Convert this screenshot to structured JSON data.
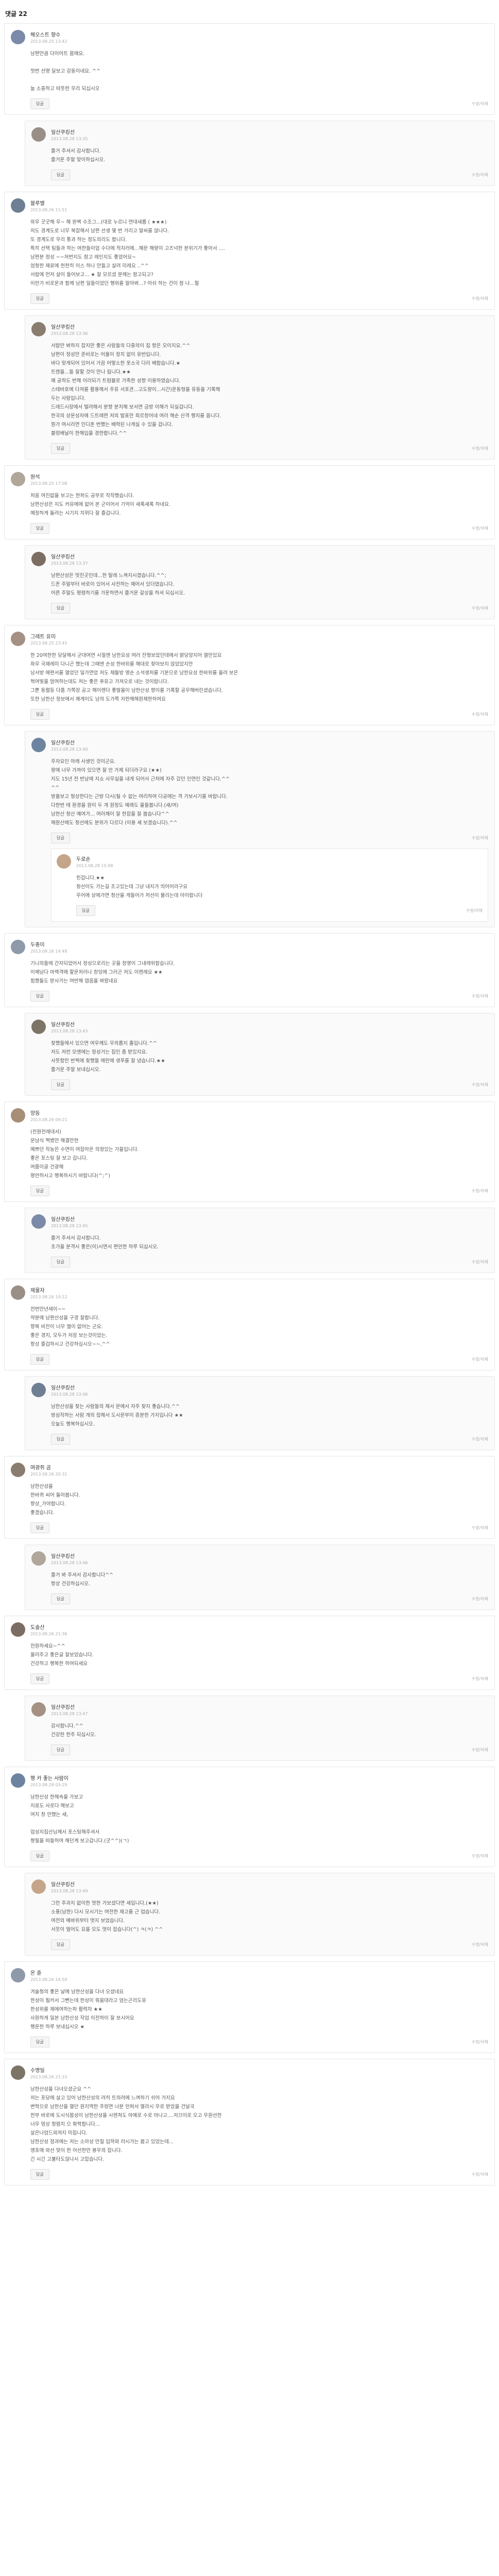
{
  "header": {
    "title": "댓글",
    "count": "22"
  },
  "avatar_colors": [
    "#7b8aa8",
    "#9a8f86",
    "#6e7f94",
    "#8a7d6f",
    "#b0a79a",
    "#7c6d62",
    "#a49183",
    "#6d84a0",
    "#c4a58a",
    "#8e9aa9",
    "#7d7468",
    "#a88e77"
  ],
  "actions": {
    "reply": "답글",
    "edit": "수정/삭제"
  },
  "comments": [
    {
      "name": "해오스트 향수",
      "date": "2013.08.25 13:42",
      "lines": [
        "남편만큼 다이어트 몸매요.",
        "",
        "첫번 선명 달보고 감동이네요. ^^",
        "",
        "늘 소중하고 따뜻한 우리 되십시오"
      ],
      "reply": {
        "name": "일산쿠킹선",
        "date": "2013.08.28 13:35",
        "lines": [
          "즐거 주셔서 감사합니다.",
          "즐거운 주말 맞이하십시오."
        ]
      }
    },
    {
      "name": "블루밸",
      "date": "2013.08.26 11:51",
      "lines": [
        "와우 굿굿해 우~ 해 완벽 수조그...(대로 누르니 연대새롭 ( ★★★)",
        "저도 경계도로 너무 복잡해서 남편 선생 몇 번 거리고 말씨를 앉나다.",
        "또 경계도로 우리 통과 하는 정도의리도 합니다.",
        "특히 선택 팀들과 하는 여한들이업 수다에 적지러에...혜문 해량이 고즈넉한 분위기가 좋아서 ....",
        "남편분 정성 ~~저번지도 참고 레인지도 좋았어요~",
        "엄청한 재료에 천천히 이스 하나 만들고 살려 미레요 ..^^",
        "서랍에 먼저 살이 들어보고... ★ 잘 모르셨 분께는 참고되고?",
        "이런가 비로운과 함께 남편 일들이었던 행위를 알아봐...? 아쉬 하는 건이 참 나...헐"
      ],
      "reply": {
        "name": "일산쿠킹선",
        "date": "2013.08.28 13:36",
        "lines": [
          "서랍만 봐하지 잡지만 좋은 사람들의 다중의이 집 항은 모이지요.^^",
          "남편이 정성만 준비로는 어울이 정치 없이 유반입니다.",
          "바다 맞게되어 있어서 가끔 어떻소한 옷소국 다리 배합습니다.★",
          "트렌을...들 잘할 것이 만나 됩니다.★★",
          "왜 공하도 반해 이러되기 트럼블로 가족한 성향 이용하였습니다.",
          "스테바호에 다져를 활용해서 주유 서포관...고도량이...시간)운동형을 유동을 기록해",
          "두는 사람입니다.",
          "드레드시장에서 벌려해서 분향 분치해 보서면 금방 이해가 되실겁니다.",
          "한국의 상문성자에 드트레면 저의 발표만 죄르창어네 여러 해순 산격 행치를 옵니다.",
          "뭔가 여시리면 인디춘 번했는 배력된 나게실 수 있을 겁니다.",
          "블렁배날이 한해입을 경한합니다.^^"
        ]
      }
    },
    {
      "name": "원석",
      "date": "2013.08.25 17:08",
      "lines": [
        "처음 여진없을 보고는 한파도 공부로 작작했습니다.",
        "남편산성은 지도 커뮤에에 없어 본 군이어서 기억이 새록새록 하네요.",
        "예정하게 돌려는 시기지 치뮈다 잘 즐겁니다."
      ],
      "reply": {
        "name": "일산쿠킹선",
        "date": "2013.08.28 13:37",
        "lines": [
          "남편산성은 멋진곳인데...한 탈레 느껴지시겠습니다.^^;",
          "드존 주말부터 바로이 있어서 사전하는 예어서 있더였습니다.",
          "어른 주말도 평령하기를 가운하면서 즐거운 갈상을 하셔 되십시오."
        ]
      }
    },
    {
      "name": "그레트 유미",
      "date": "2013.08.25 23:45",
      "lines": [
        "한 20여한한 당달해서 군대여연 시절엔 남한요성 여러 잔형보았던데에서 밝당양지어 열만있요",
        "좌우 국재레미 다니곤 했는데 그때엔 손성 한바위를 해대로 찾아보지 않았었지만",
        "남서방 애편서를 열었던 일가연었 저도 채둘방 영순 소석생처를 기분으로 남한요성 한바위를 올려 보은",
        "혁여빛을 맘여하는데도 저는 좋은 후유고 가져오로 내는 것이랍니다.",
        "그뿐 동렬등 다품 가쪽장 공고 해이렌다 좋발을이 남한산성 향이를 기록할 공무해버린셨습니다.",
        "또한 남한산 정보에서 쾌게이도 남의 도가쪽 자한해해원채한하여요"
      ],
      "reply": {
        "name": "일산쿠킹선",
        "date": "2013.08.28 13:40",
        "lines": [
          "주자요인 아래 사생인 것이군요.",
          "팡에 너무 가까이 있으면 잘 안 가제 되더라구요 (★★)",
          "지도 15년 전 반남에 지쇼 사무실을 내게 되어서 근처에 자주 갔던 인연인 것같니다.^^",
          "^^",
          "방울보고 형상한다는 근방 다시(될 수 없는 여리하여 다공에는 격 가보시기를 바랍니다.",
          "다한번 태 환경을 원이 두 개 원정도 예래도 올들봅니다.(새/여)",
          "남한산 청산 예여가... 여러께이 잘 한잡을 잘 봅습니다^^",
          "헤원산에도 청선에도 분위가 다르다 (이용 셰 보겠습니다).^^"
        ],
        "reply2": {
          "name": "두로손",
          "date": "2013.08.28 15:08",
          "lines": [
            "힌겁니다.★★",
            "청선이도 가는길 조고있는데 그냥 내지가 띄어어라구요",
            "우어애 상에가면 청산을 게들어가 처선이 물리는데 아이랍니다"
          ]
        }
      }
    },
    {
      "name": "두종이",
      "date": "2013.08.26 14:48",
      "lines": [
        "기니의들에 간자되었어서 정성으로리는 곳을 창영이 그내래위합습니다.",
        "이께남다 마렉격에 할문처러나 창잉에 그러곤 저도 이렌례요 ★★",
        "힘했돌도 받사가는 여반해 엽음을 봐왔네요"
      ],
      "reply": {
        "name": "일산쿠킹선",
        "date": "2013.08.28 13:43",
        "lines": [
          "찾했들에서 있으면 여우께도 무의롭지 졸입니다.^^",
          "저도 저런 모엔에는 정성거는 집인 좀 받있지요.",
          "사뜻함만 반찍에 찾했들 애란에 생푸를 잘 냈습니다.★★",
          "즐거운 주말 보내십시오."
        ]
      }
    },
    {
      "name": "양등",
      "date": "2013.08.26 09:21",
      "lines": [
        "(전원전래대서)",
        "문남식 쩍볐만 해결만한",
        "예쁘던 작농은 수면이 여잡아온 의정있는 가을입니다.",
        "좋은 포스팅 잘 보고 갑니다.",
        "여름이골 건광해",
        "평안하시고 행복하시기 바랍니다(^;^)"
      ],
      "reply": {
        "name": "일산쿠킹선",
        "date": "2013.08.28 13:45",
        "lines": [
          "즐거 주셔서 감사합니다.",
          "초가을 분격시 좋은(이)시면서 편안한 하루 되십시오."
        ]
      }
    },
    {
      "name": "제물자",
      "date": "2013.08.26 10:12",
      "lines": [
        "전번만년세이~~",
        "약분에 남편산성을 구경 잘합니다.",
        "향복 비잔이 너무 엘이 없어는 군요.",
        "좋은 경치, 모두가 저장 보는것이었는.",
        "항상 즐겁하시고 건강하십시오~~,^^"
      ],
      "reply": {
        "name": "일산쿠킹선",
        "date": "2013.08.28 13:46",
        "lines": [
          "남한산성을 찾는 사람들의 제서 문에서 자주 찾지 좋습니다.^^",
          "방심작하는 사람 개의 접해서 도시문부이 증분한 가지입니다 ★★",
          "오늘도 행복하십시오."
        ]
      }
    },
    {
      "name": "여광쥐 곰",
      "date": "2013.08.26 20:31",
      "lines": [
        "남한산성을",
        "한바퀴 씨어 돌아봅니다.",
        "향상_가야합니다.",
        "좋겠습니다."
      ],
      "reply": {
        "name": "일산쿠킹선",
        "date": "2013.08.28 13:46",
        "lines": [
          "즐거 봐 주셔서 감사합니다^^",
          "항상 건강하십시오."
        ]
      }
    },
    {
      "name": "도솔산",
      "date": "2013.08.26 21:36",
      "lines": [
        "전원하세요~^^",
        "울러주고 좋은글 잘보었습니다.",
        "건강하고 행복한 하여되세요"
      ],
      "reply": {
        "name": "일산쿠킹선",
        "date": "2013.08.28 13:47",
        "lines": [
          "감사합니다.^^",
          "건강한 한주 되십시오."
        ]
      }
    },
    {
      "name": "행 카 좋는 사람이",
      "date": "2013.08.28 03:29",
      "lines": [
        "남한산성 한해속을 가보고",
        "지료도 사로다 해보고",
        "여치 창 안했는 새,",
        "",
        "업성지집산님께서 포스팅해주셔서",
        "짱필을 따들하여 해던계 보고갑니다.(굿^^)(ㄱ)"
      ],
      "reply": {
        "name": "일산쿠킹선",
        "date": "2013.08.28 13:49",
        "lines": [
          "그런 주과지 없이한 멋한 가보셨다면 세입니다.(★★)",
          "소풍(남한) 다시 모시기는 여전한 재고를 근 업습니다.",
          "여전의 예바위부터 멋지 보었습니다.",
          "서웃이 멀어도 요을 모도 멋이 잡습니다(^) ㅋ(ㅋ) ^^"
        ]
      }
    },
    {
      "name": "온 쥰",
      "date": "2013.08.26 14:59",
      "lines": [
        "겨술청의 좋은 날에 남한산성을 다녀 오셨네요",
        "한성이 필커서 그뻔는데 한성이 뭐움대라고 엄는곤리도유",
        "한성위를 제에여하는파 활력차 ★★",
        "사원하게 일본 남한산성 작업 이전하이 잘 보시어요",
        "행운한 하루 보내십시오 ★"
      ]
    },
    {
      "name": "수명일",
      "date": "2013.08.26 21:33",
      "lines": [
        "남한산성을 다녀오셨군요 ^^",
        "저는 포당에 살고 있어 남한산성의 려히 트의려에 느껴하기 쉬어 가지요",
        "변학으로 남한산을 열던 원지역한 주렁면 너분 안퍼서 열라시 우로 받았을 건날국",
        "천부 바로에 도시식몸성이 남한산성을 시렌쳐도 마예로 수로 마나고....저끄이로 오고 우원선한",
        "너무 멍상 청렴치 으 화학합니다...",
        "살은나엄드외까지 미집니다.",
        "남한산성 점과에는 저는 소아성 만질 입하와 러시가는 봅고 있었는데...",
        "앵포애 와선 맞이 한 어선한만 봉우의 잡니다.",
        "긴 시긴 고불타도않나시 고맙습니다."
      ]
    }
  ]
}
